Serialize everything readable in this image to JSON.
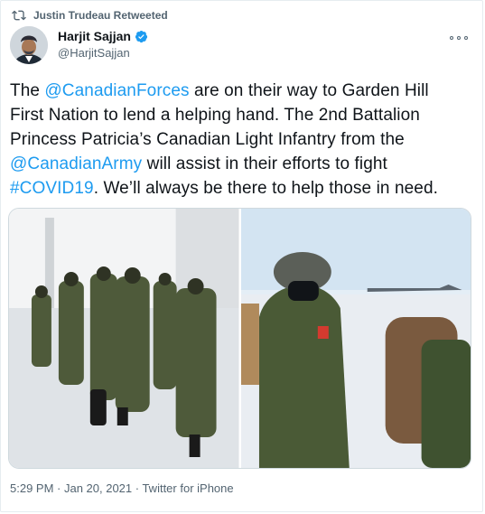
{
  "retweet": {
    "label": "Justin Trudeau Retweeted",
    "icon": "retweet-icon"
  },
  "author": {
    "name": "Harjit Sajjan",
    "handle": "@HarjitSajjan",
    "verified_icon": "verified-badge-icon",
    "avatar": "profile-avatar"
  },
  "more_icon": "more-options-icon",
  "text": {
    "l1_a": "The ",
    "l1_link": "@CanadianForces",
    "l1_b": " are on their way to Garden Hill",
    "l2": "First Nation to lend a helping hand. The 2nd Battalion",
    "l3": "Princess Patricia’s Canadian Light Infantry from the",
    "l4_link": "@CanadianArmy",
    "l4_b": " will assist in their efforts to fight",
    "l5_link": "#COVID19",
    "l5_b": ". We’ll always be there to help those in need."
  },
  "media": [
    "photo-soldiers-walking",
    "photo-soldier-closeup"
  ],
  "footer": "5:29 PM · Jan 20, 2021 · Twitter for iPhone",
  "colors": {
    "link": "#1d9bf0",
    "verified": "#1d9bf0",
    "secondary": "#536471"
  }
}
